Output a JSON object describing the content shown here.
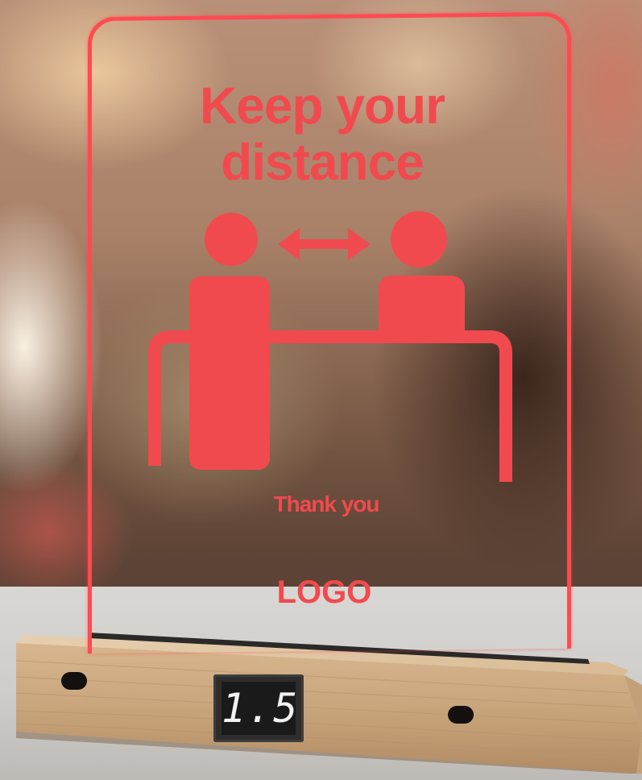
{
  "sign": {
    "headline": "Keep your distance",
    "footer_text": "Thank you",
    "logo_text": "LOGO",
    "accent_color": "#f04a4f",
    "pictogram": "two-people-at-table-with-distance-arrow"
  },
  "base": {
    "display_value": "1.5",
    "material": "light-wood"
  }
}
